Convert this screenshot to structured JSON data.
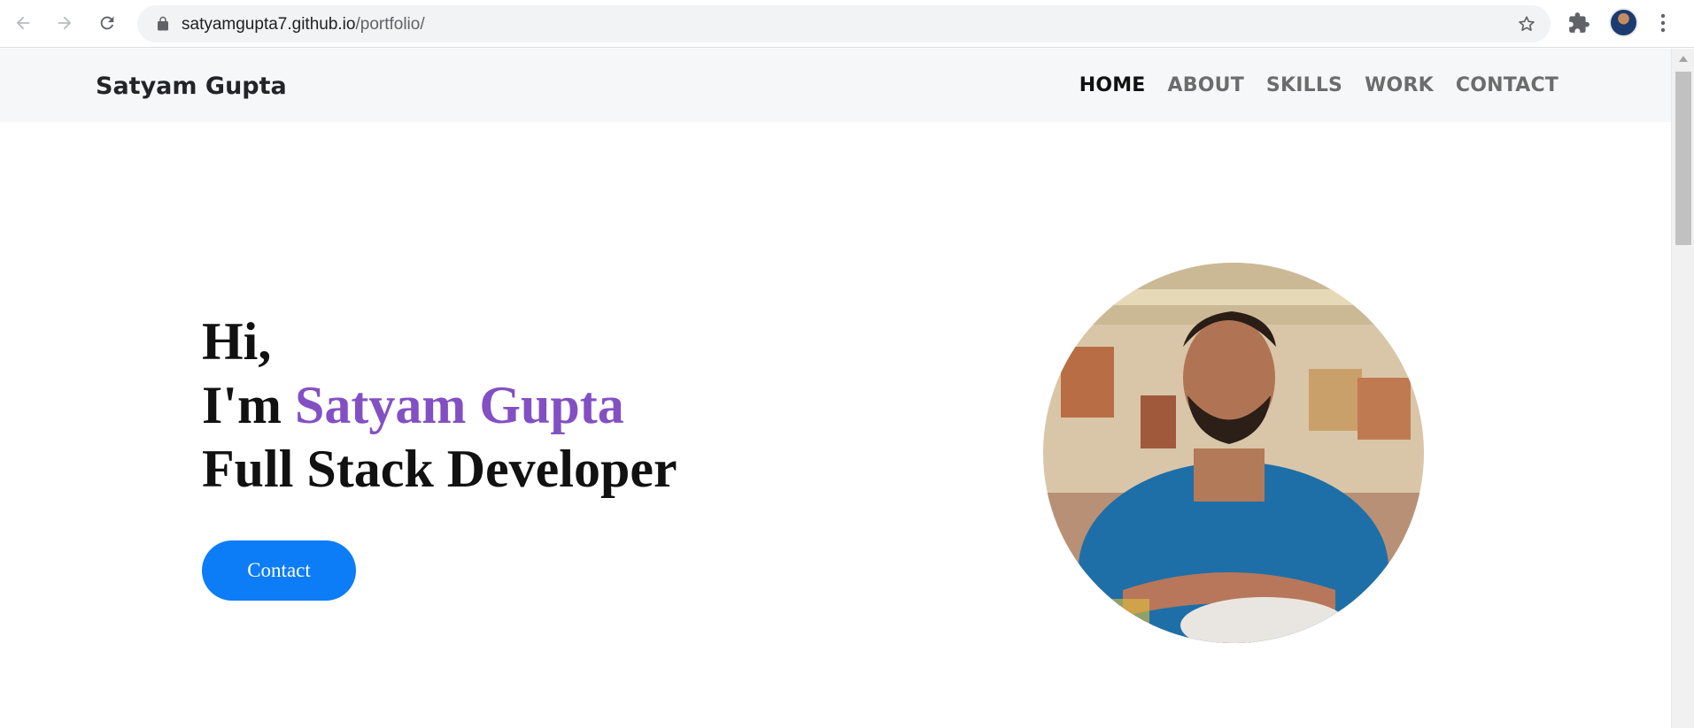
{
  "browser": {
    "url_host": "satyamgupta7.github.io",
    "url_path": "/portfolio/",
    "icons": [
      "back-arrow-icon",
      "forward-arrow-icon",
      "reload-icon",
      "lock-icon",
      "bookmark-star-icon",
      "extensions-puzzle-icon",
      "profile-avatar",
      "kebab-menu-icon"
    ]
  },
  "site": {
    "brand": "Satyam Gupta",
    "menu": {
      "home": "HOME",
      "about": "ABOUT",
      "skills": "SKILLS",
      "work": "WORK",
      "contact": "CONTACT"
    },
    "active_menu": "HOME"
  },
  "hero": {
    "greeting": "Hi,",
    "intro_prefix": "I'm ",
    "name": "Satyam Gupta",
    "role": "Full Stack Developer",
    "contact_button": "Contact"
  },
  "colors": {
    "accent_name": "#8350c4",
    "button_primary": "#0d7cf7",
    "nav_bg": "#f6f7f8"
  }
}
